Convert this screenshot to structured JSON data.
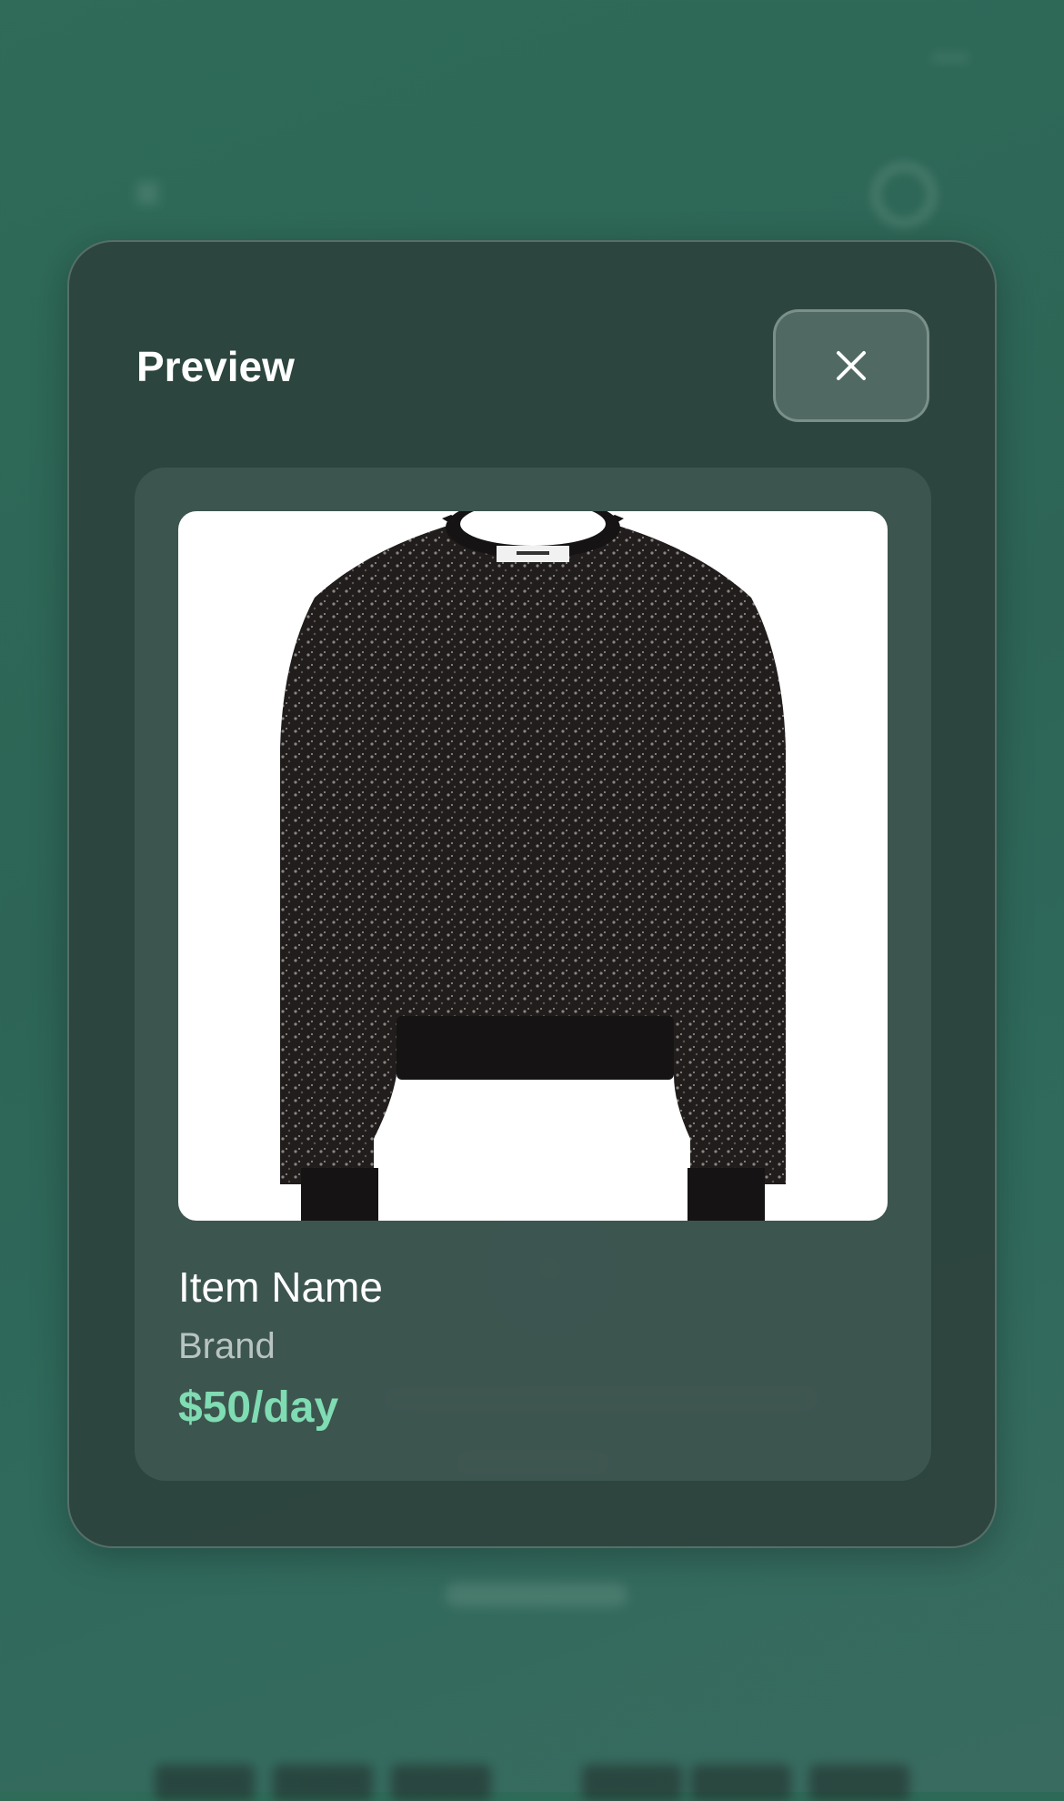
{
  "modal": {
    "title": "Preview",
    "close_icon": "close-icon"
  },
  "item": {
    "name": "Item Name",
    "brand": "Brand",
    "price": "$50/day",
    "image": "black-sequin-sweater"
  },
  "colors": {
    "accent_price": "#7fdcb3",
    "modal_bg": "#2e423d",
    "page_bg": "#2f6b58"
  }
}
